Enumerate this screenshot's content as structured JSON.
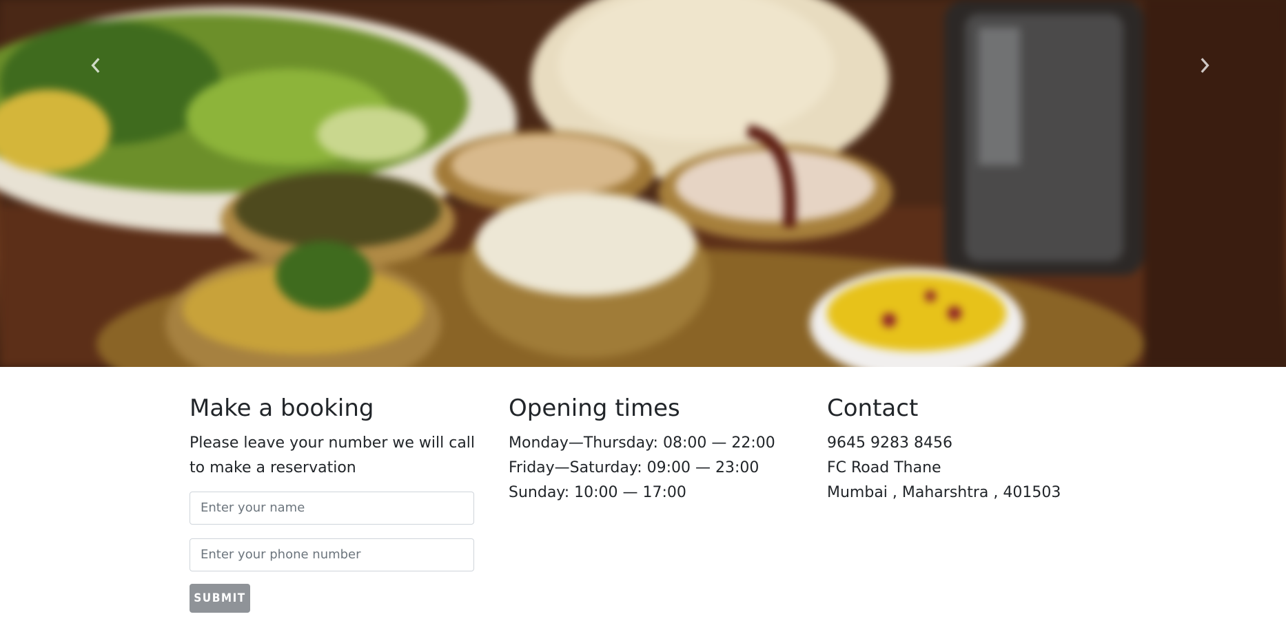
{
  "hero": {
    "prev_icon": "chevron-left-icon",
    "next_icon": "chevron-right-icon"
  },
  "booking": {
    "title": "Make a booking",
    "intro": "Please leave your number we will call to make a reservation",
    "name_placeholder": "Enter your name",
    "phone_placeholder": "Enter your phone number",
    "submit_label": "SUBMIT"
  },
  "hours": {
    "title": "Opening times",
    "lines": [
      "Monday—Thursday: 08:00 — 22:00",
      "Friday—Saturday: 09:00 — 23:00",
      "Sunday: 10:00 — 17:00"
    ]
  },
  "contact": {
    "title": "Contact",
    "lines": [
      "9645 9283 8456",
      "FC Road Thane",
      "Mumbai , Maharshtra , 401503"
    ]
  },
  "colors": {
    "button_bg": "#8f9398",
    "text": "#212529",
    "input_border": "#ced4da"
  }
}
